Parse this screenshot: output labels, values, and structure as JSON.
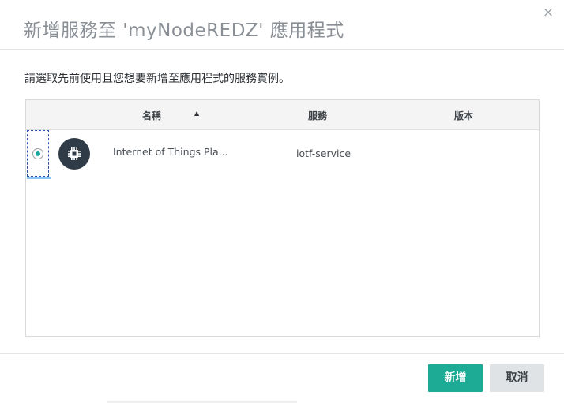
{
  "dialog": {
    "title": "新增服務至 'myNodeREDZ' 應用程式",
    "close_label": "×",
    "instruction": "請選取先前使用且您想要新增至應用程式的服務實例。"
  },
  "table": {
    "columns": {
      "name": "名稱",
      "service": "服務",
      "version": "版本"
    },
    "sort_indicator": "▲",
    "sort_column": "名稱",
    "sort_direction": "ascending",
    "rows": [
      {
        "selected": true,
        "icon": "iot-chip-icon",
        "name": "Internet of Things Pla...",
        "service": "iotf-service",
        "version": ""
      }
    ]
  },
  "buttons": {
    "add_label": "新增",
    "cancel_label": "取消"
  },
  "colors": {
    "title": "#8a8f96",
    "accent": "#1eab95",
    "radio_selected": "#1aa69a",
    "cancel_bg": "#dfe3e6",
    "header_bg": "#f4f4f4",
    "icon_bg": "#2f3b46"
  }
}
